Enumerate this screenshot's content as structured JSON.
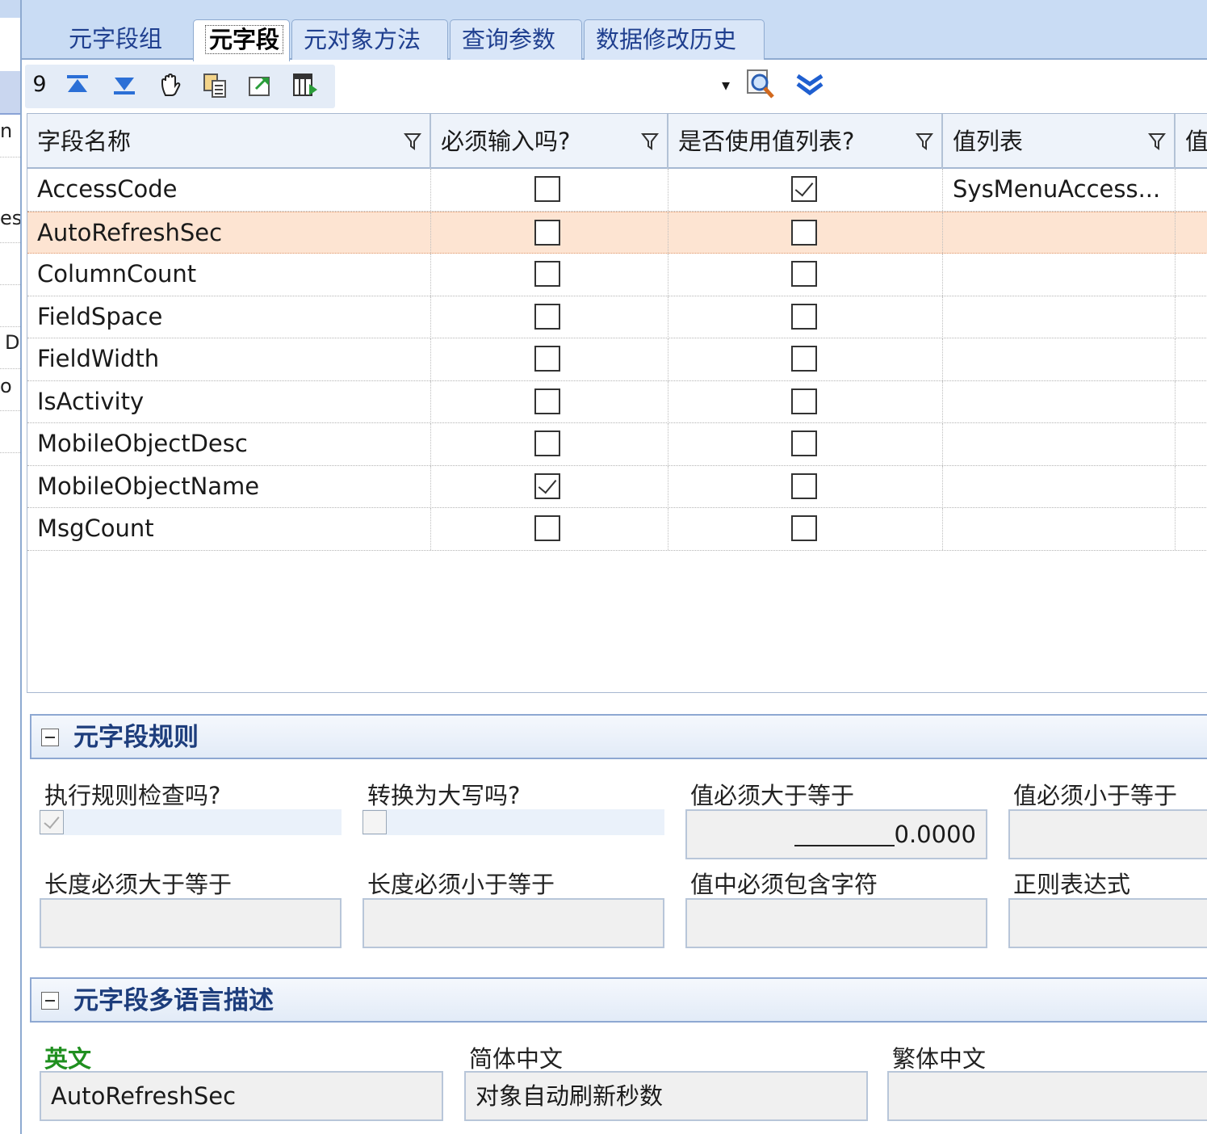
{
  "left_fragments": [
    "n",
    "es",
    "D",
    "o"
  ],
  "tabs": [
    {
      "label": "元字段组"
    },
    {
      "label": "元字段"
    },
    {
      "label": "元对象方法"
    },
    {
      "label": "查询参数"
    },
    {
      "label": "数据修改历史"
    }
  ],
  "toolbar": {
    "record_count": "9",
    "dropdown_arrow": "▾",
    "icons": [
      "first-record-icon",
      "last-record-icon",
      "hand-icon",
      "copy-icon",
      "export-icon",
      "column-chooser-icon",
      "search-icon",
      "expand-down-icon"
    ]
  },
  "grid": {
    "columns": [
      {
        "label": "字段名称"
      },
      {
        "label": "必须输入吗?"
      },
      {
        "label": "是否使用值列表?"
      },
      {
        "label": "值列表"
      },
      {
        "label": "值"
      }
    ],
    "rows": [
      {
        "name": "AccessCode",
        "required": false,
        "use_list": true,
        "list": "SysMenuAccess..."
      },
      {
        "name": "AutoRefreshSec",
        "required": false,
        "use_list": false,
        "list": ""
      },
      {
        "name": "ColumnCount",
        "required": false,
        "use_list": false,
        "list": ""
      },
      {
        "name": "FieldSpace",
        "required": false,
        "use_list": false,
        "list": ""
      },
      {
        "name": "FieldWidth",
        "required": false,
        "use_list": false,
        "list": ""
      },
      {
        "name": "IsActivity",
        "required": false,
        "use_list": false,
        "list": ""
      },
      {
        "name": "MobileObjectDesc",
        "required": false,
        "use_list": false,
        "list": ""
      },
      {
        "name": "MobileObjectName",
        "required": true,
        "use_list": false,
        "list": ""
      },
      {
        "name": "MsgCount",
        "required": false,
        "use_list": false,
        "list": ""
      }
    ],
    "selected_row": 1
  },
  "rules": {
    "title": "元字段规则",
    "check_rules_label": "执行规则检查吗?",
    "check_rules_value": true,
    "uppercase_label": "转换为大写吗?",
    "uppercase_value": false,
    "min_value_label": "值必须大于等于",
    "min_value": "0.0000",
    "max_value_label": "值必须小于等于",
    "max_value": "",
    "min_length_label": "长度必须大于等于",
    "min_length": "",
    "max_length_label": "长度必须小于等于",
    "max_length": "",
    "contains_label": "值中必须包含字符",
    "contains": "",
    "regex_label": "正则表达式",
    "regex": ""
  },
  "multilang": {
    "title": "元字段多语言描述",
    "english_label": "英文",
    "english_value": "AutoRefreshSec",
    "simplified_label": "简体中文",
    "simplified_value": "对象自动刷新秒数",
    "traditional_label": "繁体中文",
    "traditional_value": ""
  },
  "colors": {
    "accent": "#c9dcf4",
    "selected_row": "#fde4d2",
    "section_title": "#1d3d7c",
    "english_label": "#1f8f1f"
  }
}
